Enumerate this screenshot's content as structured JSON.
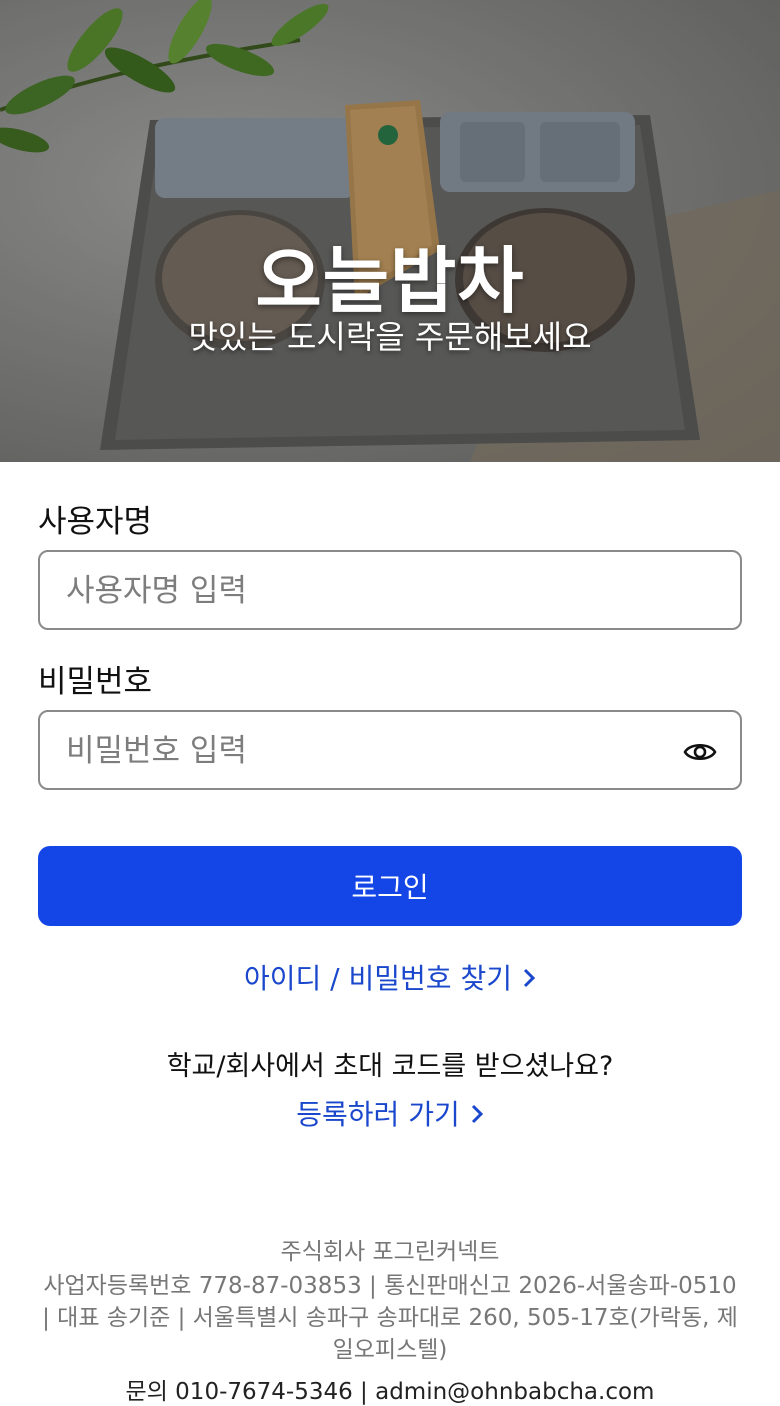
{
  "hero": {
    "title": "오늘밥차",
    "subtitle": "맛있는 도시락을 주문해보세요"
  },
  "form": {
    "username": {
      "label": "사용자명",
      "placeholder": "사용자명 입력",
      "value": ""
    },
    "password": {
      "label": "비밀번호",
      "placeholder": "비밀번호 입력",
      "value": "",
      "toggle_icon": "eye-icon"
    },
    "login_label": "로그인",
    "find_account_label": "아이디 / 비밀번호 찾기"
  },
  "invite": {
    "question": "학교/회사에서 초대 코드를 받으셨나요?",
    "register_label": "등록하러 가기"
  },
  "footer": {
    "company": "주식회사 포그린커넥트",
    "info": "사업자등록번호 778-87-03853 | 통신판매신고 2026-서울송파-0510 | 대표 송기준 | 서울특별시 송파구 송파대로 260, 505-17호(가락동, 제일오피스텔)",
    "contact": "문의 010-7674-5346 | admin@ohnbabcha.com"
  },
  "colors": {
    "primary": "#1445e6",
    "link": "#1a47cc",
    "footer_text": "#777777"
  }
}
